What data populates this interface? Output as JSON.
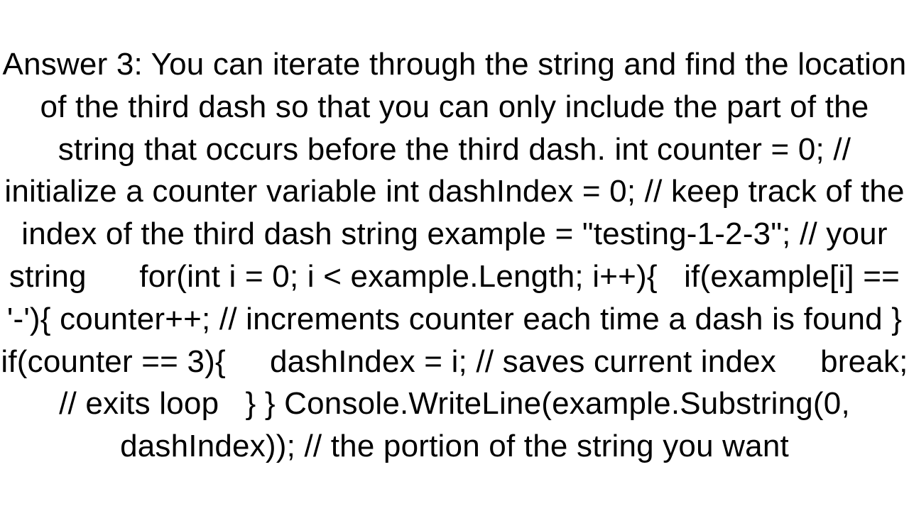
{
  "content": {
    "body": "Answer 3: You can iterate through the string and find the location of the third dash so that you can only include the part of the string that occurs before the third dash. int counter = 0; // initialize a counter variable int dashIndex = 0; // keep track of the index of the third dash string example = \"testing-1-2-3\"; // your string      for(int i = 0; i < example.Length; i++){   if(example[i] == '-'){ counter++; // increments counter each time a dash is found }    if(counter == 3){     dashIndex = i; // saves current index     break; // exits loop   } } Console.WriteLine(example.Substring(0, dashIndex)); // the portion of the string you want"
  }
}
